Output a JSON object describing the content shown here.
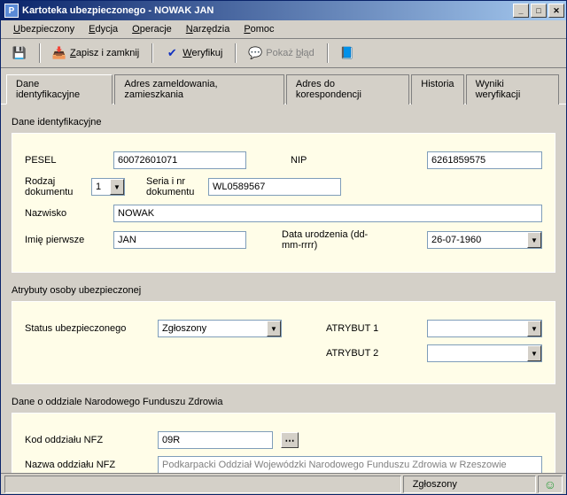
{
  "window": {
    "title": "Kartoteka ubezpieczonego - NOWAK JAN",
    "app_icon_letter": "P"
  },
  "menu": {
    "ubezpieczony": "Ubezpieczony",
    "edycja": "Edycja",
    "operacje": "Operacje",
    "narzedzia": "Narzędzia",
    "pomoc": "Pomoc"
  },
  "toolbar": {
    "save_close": "Zapisz i zamknij",
    "verify": "Weryfikuj",
    "show_error": "Pokaż błąd"
  },
  "tabs": {
    "identyfikacyjne": "Dane identyfikacyjne",
    "adres_zam": "Adres zameldowania, zamieszkania",
    "adres_kor": "Adres do korespondencji",
    "historia": "Historia",
    "wyniki": "Wyniki weryfikacji"
  },
  "group_labels": {
    "dane_id": "Dane identyfikacyjne",
    "atrybuty": "Atrybuty osoby ubezpieczonej",
    "oddzial": "Dane o oddziale Narodowego Funduszu Zdrowia"
  },
  "form": {
    "pesel_label": "PESEL",
    "pesel_value": "60072601071",
    "nip_label": "NIP",
    "nip_value": "6261859575",
    "rodzaj_dok_label": "Rodzaj dokumentu",
    "rodzaj_dok_value": "1",
    "seria_label": "Seria i nr dokumentu",
    "seria_value": "WL0589567",
    "nazwisko_label": "Nazwisko",
    "nazwisko_value": "NOWAK",
    "imie_label": "Imię pierwsze",
    "imie_value": "JAN",
    "data_ur_label": "Data urodzenia (dd-mm-rrrr)",
    "data_ur_value": "26-07-1960",
    "status_label": "Status ubezpieczonego",
    "status_value": "Zgłoszony",
    "atrybut1_label": "ATRYBUT 1",
    "atrybut1_value": "",
    "atrybut2_label": "ATRYBUT 2",
    "atrybut2_value": "",
    "kod_label": "Kod oddziału NFZ",
    "kod_value": "09R",
    "nazwa_label": "Nazwa oddziału NFZ",
    "nazwa_value": "Podkarpacki Oddział Wojewódzki Narodowego Funduszu Zdrowia w Rzeszowie"
  },
  "status": {
    "text": "Zgłoszony"
  }
}
